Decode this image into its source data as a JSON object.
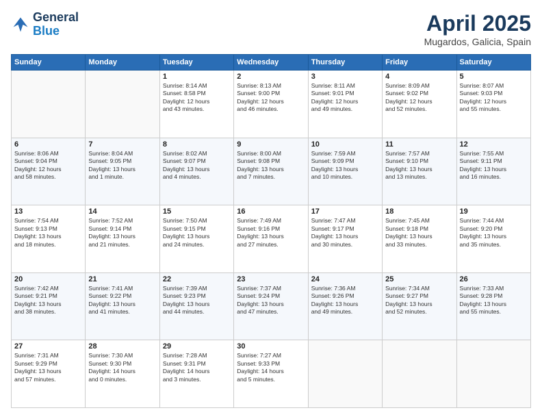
{
  "header": {
    "logo_line1": "General",
    "logo_line2": "Blue",
    "title": "April 2025",
    "subtitle": "Mugardos, Galicia, Spain"
  },
  "weekdays": [
    "Sunday",
    "Monday",
    "Tuesday",
    "Wednesday",
    "Thursday",
    "Friday",
    "Saturday"
  ],
  "weeks": [
    [
      {
        "day": "",
        "info": ""
      },
      {
        "day": "",
        "info": ""
      },
      {
        "day": "1",
        "info": "Sunrise: 8:14 AM\nSunset: 8:58 PM\nDaylight: 12 hours\nand 43 minutes."
      },
      {
        "day": "2",
        "info": "Sunrise: 8:13 AM\nSunset: 9:00 PM\nDaylight: 12 hours\nand 46 minutes."
      },
      {
        "day": "3",
        "info": "Sunrise: 8:11 AM\nSunset: 9:01 PM\nDaylight: 12 hours\nand 49 minutes."
      },
      {
        "day": "4",
        "info": "Sunrise: 8:09 AM\nSunset: 9:02 PM\nDaylight: 12 hours\nand 52 minutes."
      },
      {
        "day": "5",
        "info": "Sunrise: 8:07 AM\nSunset: 9:03 PM\nDaylight: 12 hours\nand 55 minutes."
      }
    ],
    [
      {
        "day": "6",
        "info": "Sunrise: 8:06 AM\nSunset: 9:04 PM\nDaylight: 12 hours\nand 58 minutes."
      },
      {
        "day": "7",
        "info": "Sunrise: 8:04 AM\nSunset: 9:05 PM\nDaylight: 13 hours\nand 1 minute."
      },
      {
        "day": "8",
        "info": "Sunrise: 8:02 AM\nSunset: 9:07 PM\nDaylight: 13 hours\nand 4 minutes."
      },
      {
        "day": "9",
        "info": "Sunrise: 8:00 AM\nSunset: 9:08 PM\nDaylight: 13 hours\nand 7 minutes."
      },
      {
        "day": "10",
        "info": "Sunrise: 7:59 AM\nSunset: 9:09 PM\nDaylight: 13 hours\nand 10 minutes."
      },
      {
        "day": "11",
        "info": "Sunrise: 7:57 AM\nSunset: 9:10 PM\nDaylight: 13 hours\nand 13 minutes."
      },
      {
        "day": "12",
        "info": "Sunrise: 7:55 AM\nSunset: 9:11 PM\nDaylight: 13 hours\nand 16 minutes."
      }
    ],
    [
      {
        "day": "13",
        "info": "Sunrise: 7:54 AM\nSunset: 9:13 PM\nDaylight: 13 hours\nand 18 minutes."
      },
      {
        "day": "14",
        "info": "Sunrise: 7:52 AM\nSunset: 9:14 PM\nDaylight: 13 hours\nand 21 minutes."
      },
      {
        "day": "15",
        "info": "Sunrise: 7:50 AM\nSunset: 9:15 PM\nDaylight: 13 hours\nand 24 minutes."
      },
      {
        "day": "16",
        "info": "Sunrise: 7:49 AM\nSunset: 9:16 PM\nDaylight: 13 hours\nand 27 minutes."
      },
      {
        "day": "17",
        "info": "Sunrise: 7:47 AM\nSunset: 9:17 PM\nDaylight: 13 hours\nand 30 minutes."
      },
      {
        "day": "18",
        "info": "Sunrise: 7:45 AM\nSunset: 9:18 PM\nDaylight: 13 hours\nand 33 minutes."
      },
      {
        "day": "19",
        "info": "Sunrise: 7:44 AM\nSunset: 9:20 PM\nDaylight: 13 hours\nand 35 minutes."
      }
    ],
    [
      {
        "day": "20",
        "info": "Sunrise: 7:42 AM\nSunset: 9:21 PM\nDaylight: 13 hours\nand 38 minutes."
      },
      {
        "day": "21",
        "info": "Sunrise: 7:41 AM\nSunset: 9:22 PM\nDaylight: 13 hours\nand 41 minutes."
      },
      {
        "day": "22",
        "info": "Sunrise: 7:39 AM\nSunset: 9:23 PM\nDaylight: 13 hours\nand 44 minutes."
      },
      {
        "day": "23",
        "info": "Sunrise: 7:37 AM\nSunset: 9:24 PM\nDaylight: 13 hours\nand 47 minutes."
      },
      {
        "day": "24",
        "info": "Sunrise: 7:36 AM\nSunset: 9:26 PM\nDaylight: 13 hours\nand 49 minutes."
      },
      {
        "day": "25",
        "info": "Sunrise: 7:34 AM\nSunset: 9:27 PM\nDaylight: 13 hours\nand 52 minutes."
      },
      {
        "day": "26",
        "info": "Sunrise: 7:33 AM\nSunset: 9:28 PM\nDaylight: 13 hours\nand 55 minutes."
      }
    ],
    [
      {
        "day": "27",
        "info": "Sunrise: 7:31 AM\nSunset: 9:29 PM\nDaylight: 13 hours\nand 57 minutes."
      },
      {
        "day": "28",
        "info": "Sunrise: 7:30 AM\nSunset: 9:30 PM\nDaylight: 14 hours\nand 0 minutes."
      },
      {
        "day": "29",
        "info": "Sunrise: 7:28 AM\nSunset: 9:31 PM\nDaylight: 14 hours\nand 3 minutes."
      },
      {
        "day": "30",
        "info": "Sunrise: 7:27 AM\nSunset: 9:33 PM\nDaylight: 14 hours\nand 5 minutes."
      },
      {
        "day": "",
        "info": ""
      },
      {
        "day": "",
        "info": ""
      },
      {
        "day": "",
        "info": ""
      }
    ]
  ]
}
